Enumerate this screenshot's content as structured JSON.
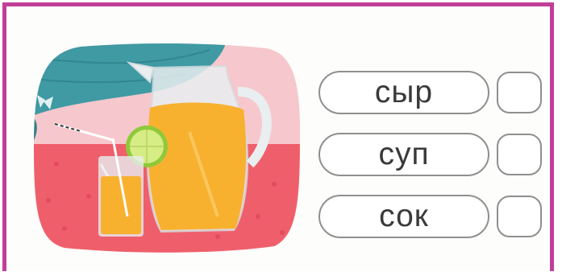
{
  "exercise": {
    "illustration_name": "pitcher-and-glass-of-juice",
    "words": [
      {
        "label": "сыр"
      },
      {
        "label": "суп"
      },
      {
        "label": "сок"
      }
    ]
  },
  "colors": {
    "frame_border": "#c13f98",
    "pill_border": "#8f8f8f",
    "table_red": "#ef5f6b",
    "wall_pink": "#f6c7cc",
    "curtain_teal": "#3f9aa3",
    "juice_orange": "#f7b12f"
  }
}
